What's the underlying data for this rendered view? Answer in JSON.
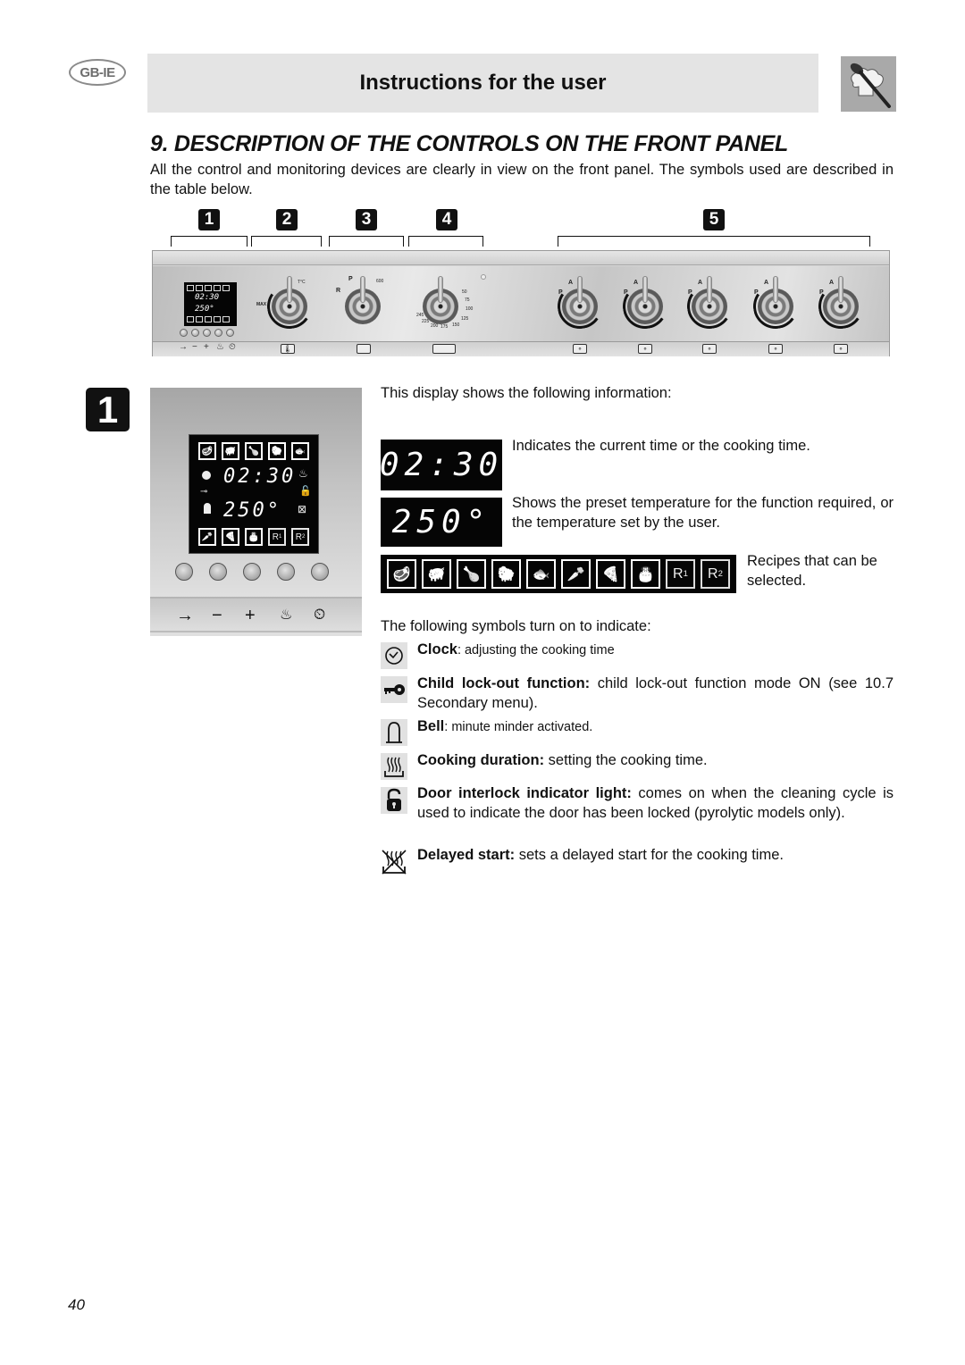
{
  "header": {
    "language_badge": "GB-IE",
    "title": "Instructions for the user",
    "logo_icon": "chef-hat-spoon-icon"
  },
  "section": {
    "title": "9. DESCRIPTION OF THE CONTROLS ON THE FRONT PANEL",
    "intro": "All the control and monitoring devices are clearly in view on the front panel. The symbols used are described in the table below."
  },
  "panel_callouts": [
    "1",
    "2",
    "3",
    "4",
    "5"
  ],
  "front_panel": {
    "mini_display": {
      "time": "02:30",
      "temp": "250°"
    },
    "mini_button_symbols": [
      "→",
      "−",
      "+",
      "♨",
      "⏲"
    ],
    "knob1": {
      "label_top": "T°C",
      "label_left": "MAX"
    },
    "knob2": {
      "label_top": "P",
      "label_left": "R",
      "label_right": "600"
    },
    "knob3": {
      "scale": [
        "50",
        "75",
        "100",
        "125",
        "150",
        "175",
        "200",
        "225",
        "245"
      ]
    },
    "hob_knob_labels": {
      "top": "A",
      "left": "P"
    },
    "hob_knob_count": 5
  },
  "figure1": {
    "badge": "1",
    "display": {
      "time": "02:30",
      "temp": "250°",
      "top_recipes": [
        "beef-icon",
        "pork-icon",
        "chicken-icon",
        "lamb-icon",
        "fish-icon"
      ],
      "bottom_recipes": [
        "vegetables-icon",
        "pizza-icon",
        "cake-icon",
        "R1",
        "R2"
      ]
    },
    "strip_symbols": [
      "→",
      "−",
      "+",
      "♨",
      "⏲"
    ]
  },
  "description": {
    "lead": "This display shows the following information:",
    "time_display": "02:30",
    "time_text": "Indicates the current time or the cooking time.",
    "temp_display": "250°",
    "temp_text": "Shows the preset temperature for the function required, or the temperature set by the user.",
    "recipes": [
      "beef-icon",
      "pork-icon",
      "chicken-icon",
      "lamb-icon",
      "fish-icon",
      "vegetables-icon",
      "pizza-icon",
      "cake-icon",
      "R1",
      "R2"
    ],
    "recipes_text": "Recipes that can be selected.",
    "symbols_lead": "The following symbols turn on to indicate:",
    "symbols": [
      {
        "icon": "clock-icon",
        "glyph": "⏲",
        "title": "Clock",
        "text": ": adjusting the cooking time"
      },
      {
        "icon": "key-icon",
        "glyph": "⊸",
        "title": "Child lock-out function:",
        "text": " child lock-out function mode ON (see 10.7 Secondary menu)."
      },
      {
        "icon": "bell-icon",
        "glyph": "∩",
        "title": "Bell",
        "text": ": minute minder activated."
      },
      {
        "icon": "cooking-duration-icon",
        "glyph": "♨",
        "title": "Cooking duration:",
        "text": " setting the cooking time."
      },
      {
        "icon": "padlock-icon",
        "glyph": "🔓",
        "title": "Door interlock indicator light:",
        "text": " comes on when the cleaning cycle is used to indicate the door has been locked (pyrolytic models only)."
      },
      {
        "icon": "delayed-start-icon",
        "glyph": "⊠",
        "title": "Delayed start:",
        "text": " sets a delayed start for the cooking time."
      }
    ]
  },
  "page_number": "40"
}
